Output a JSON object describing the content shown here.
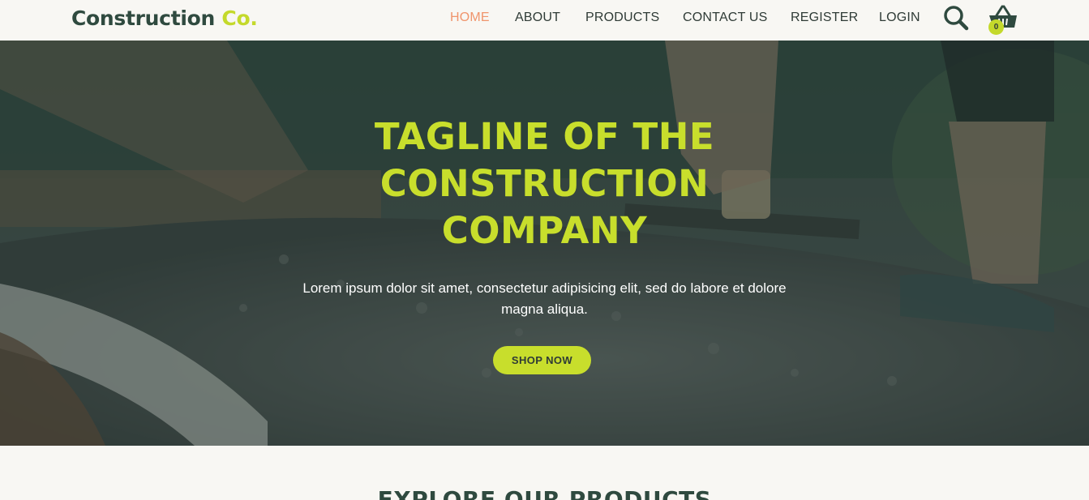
{
  "brand": {
    "name_main": "Construction",
    "name_accent": "Co.",
    "primary_color": "#2f4a3f",
    "accent_color": "#c8de2c",
    "active_nav_color": "#f0956c"
  },
  "nav": {
    "items": [
      {
        "label": "HOME",
        "active": true
      },
      {
        "label": "ABOUT",
        "active": false
      },
      {
        "label": "PRODUCTS",
        "active": false
      },
      {
        "label": "CONTACT US",
        "active": false
      },
      {
        "label": "REGISTER",
        "active": false
      },
      {
        "label": "LOGIN",
        "active": false
      }
    ],
    "search_icon": "search-icon",
    "cart_icon": "shopping-basket-icon",
    "cart_count": "0"
  },
  "hero": {
    "title": "TAGLINE OF THE CONSTRUCTION COMPANY",
    "subtitle": "Lorem ipsum dolor sit amet, consectetur adipisicing elit, sed do labore et dolore magna aliqua.",
    "cta_label": "SHOP NOW"
  },
  "products": {
    "section_title": "EXPLORE OUR PRODUCTS"
  }
}
